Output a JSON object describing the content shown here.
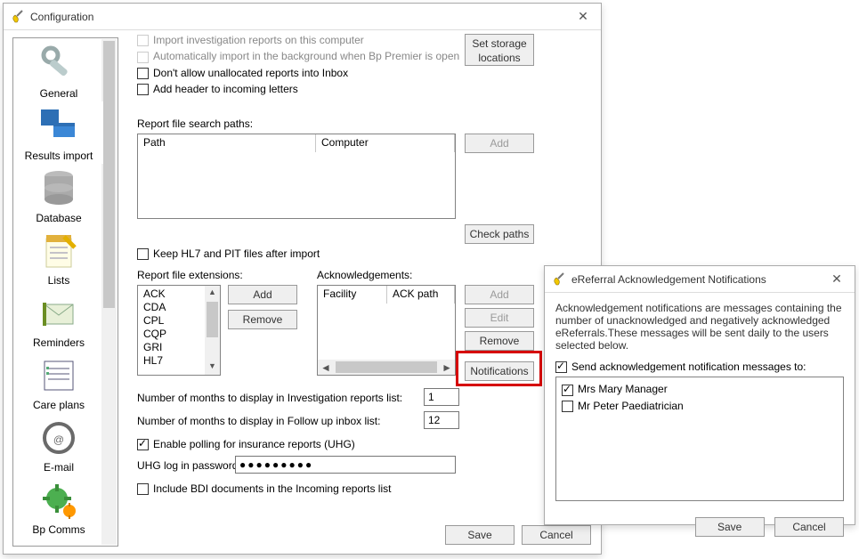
{
  "window": {
    "title": "Configuration"
  },
  "sidebar": {
    "items": [
      {
        "label": "General"
      },
      {
        "label": "Results import"
      },
      {
        "label": "Database"
      },
      {
        "label": "Lists"
      },
      {
        "label": "Reminders"
      },
      {
        "label": "Care plans"
      },
      {
        "label": "E-mail"
      },
      {
        "label": "Bp Comms"
      }
    ]
  },
  "top": {
    "cb_import": "Import investigation reports on this computer",
    "cb_auto": "Automatically import in the background when Bp Premier is open",
    "cb_unalloc": "Don't allow unallocated reports into Inbox",
    "cb_header": "Add header to incoming letters",
    "btn_storage": "Set storage locations"
  },
  "search_paths": {
    "label": "Report file search paths:",
    "col_path": "Path",
    "col_computer": "Computer",
    "btn_add": "Add",
    "btn_check": "Check paths",
    "cb_keep": "Keep HL7 and PIT files after import"
  },
  "extensions": {
    "label": "Report file extensions:",
    "items": [
      "ACK",
      "CDA",
      "CPL",
      "CQP",
      "GRI",
      "HL7"
    ],
    "btn_add": "Add",
    "btn_remove": "Remove"
  },
  "ack": {
    "label": "Acknowledgements:",
    "col_facility": "Facility",
    "col_ackpath": "ACK path",
    "btn_add": "Add",
    "btn_edit": "Edit",
    "btn_remove": "Remove",
    "btn_notif": "Notifications"
  },
  "rows": {
    "months_investigation": {
      "label": "Number of months to display in Investigation reports list:",
      "value": "1"
    },
    "months_followup": {
      "label": "Number of months to display in Follow up inbox list:",
      "value": "12"
    },
    "cb_polling": "Enable polling for insurance reports (UHG)",
    "uhg_label": "UHG log in password:",
    "uhg_value": "●●●●●●●●●",
    "cb_bdi": "Include BDI documents in the Incoming reports list"
  },
  "footer": {
    "save": "Save",
    "cancel": "Cancel"
  },
  "popup": {
    "title": "eReferral Acknowledgement Notifications",
    "desc": "Acknowledgement notifications are messages containing the number of unacknowledged and negatively acknowledged eReferrals.These messages will be sent daily to the users selected below.",
    "cb_send": "Send acknowledgement notification messages to:",
    "users": [
      {
        "name": "Mrs Mary Manager",
        "checked": true
      },
      {
        "name": "Mr Peter Paediatrician",
        "checked": false
      }
    ],
    "save": "Save",
    "cancel": "Cancel"
  }
}
